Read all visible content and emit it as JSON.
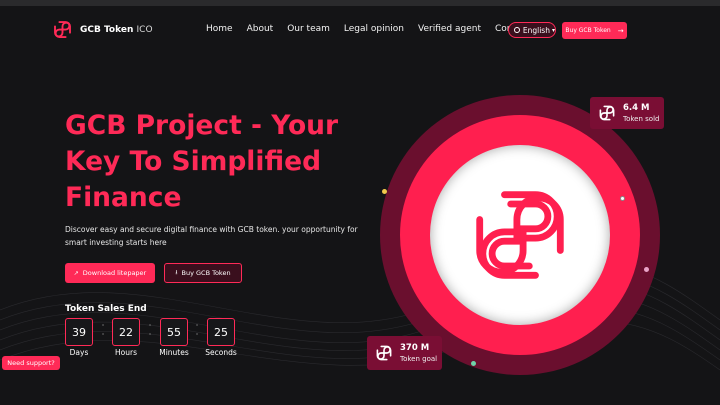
{
  "brand": {
    "name": "GCB Token",
    "suffix": "ICO"
  },
  "nav": [
    "Home",
    "About",
    "Our team",
    "Legal opinion",
    "Verified agent",
    "Contact"
  ],
  "language": {
    "label": "English"
  },
  "header_cta": "Buy GCB Token",
  "hero": {
    "title_lines": [
      "GCB Project - Your",
      "Key To Simplified",
      "Finance"
    ],
    "description": "Discover easy and secure digital finance with GCB token. your opportunity for smart investing starts here",
    "primary_button": "Download litepaper",
    "secondary_button": "Buy GCB Token"
  },
  "countdown": {
    "title": "Token Sales End",
    "units": [
      {
        "value": "39",
        "label": "Days"
      },
      {
        "value": "22",
        "label": "Hours"
      },
      {
        "value": "55",
        "label": "Minutes"
      },
      {
        "value": "25",
        "label": "Seconds"
      }
    ]
  },
  "stats": {
    "sold": {
      "value": "6.4 M",
      "label": "Token sold"
    },
    "goal": {
      "value": "370 M",
      "label": "Token goal"
    }
  },
  "support": "Need support?",
  "colors": {
    "accent": "#ff2a57",
    "background": "#141416",
    "dark_ring": "#6a0f2e",
    "stat_bg": "#7a0e34"
  }
}
